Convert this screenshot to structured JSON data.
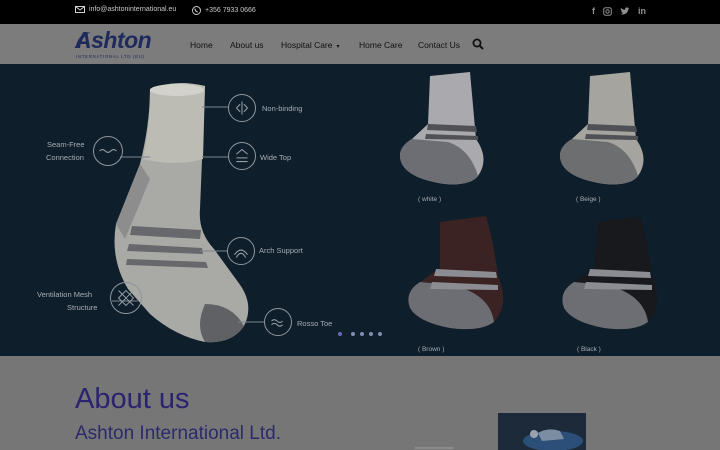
{
  "topbar": {
    "email": "info@ashtoninternational.eu",
    "phone": "+356 7933 0666",
    "social": [
      "facebook-icon",
      "instagram-icon",
      "twitter-icon",
      "linkedin-icon"
    ]
  },
  "brand": {
    "name": "Ashton",
    "tagline": "INTERNATIONAL LTD (EU)"
  },
  "nav": {
    "items": [
      "Home",
      "About us",
      "Hospital Care",
      "Home Care",
      "Contact Us"
    ],
    "hospital_care_caret": "▾"
  },
  "hero": {
    "features": [
      "Non-binding",
      "Wide Top",
      "Arch Support",
      "Rosso Toe",
      "Seam-Free",
      "Connection",
      "Ventilation Mesh",
      "Structure"
    ],
    "variants": [
      "( white )",
      "( Beige )",
      "( Brown )",
      "( Black )"
    ],
    "slide_count": 5,
    "active_slide": 1
  },
  "about": {
    "title": "About us",
    "subtitle": "Ashton International Ltd."
  },
  "colors": {
    "topbar_bg": "#000000",
    "nav_bg": "#7c7c7c",
    "hero_bg": "#0f1e2b",
    "page_bg": "#767676",
    "heading": "#2a2370"
  }
}
